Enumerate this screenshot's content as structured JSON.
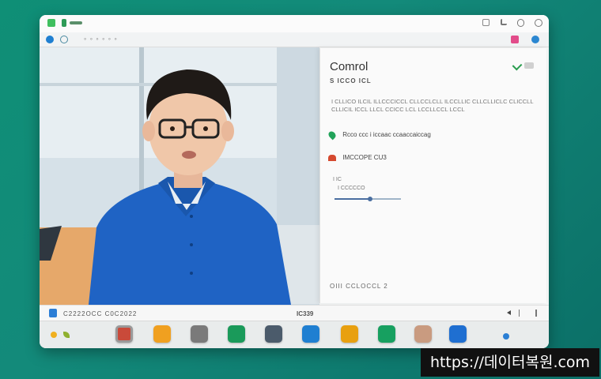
{
  "toolbar": {
    "address": "◦ ◦ ◦ ◦ ◦ ◦"
  },
  "panel": {
    "title": "Comrol",
    "subtitle": "S ICCO ICL",
    "description": "I CLLICO ILCIL ILLCCCICCL CLLCCLCLL ILCCLLIC CLLCLLICLC CLICCLL CLLICIL ICCL LLCL CCICC LCL LCCLLCCL LCCL",
    "option1": "Rcco ccc i iccaac ccaaccaiccag",
    "option2": "IMCCOPE CU3",
    "slider_label": "I IC",
    "slider_value_label": "I CCCCCO",
    "footer": "OIII CCLOCCL 2"
  },
  "statusbar": {
    "left": "C2222OCC C0C2022",
    "center": "IC339"
  },
  "colors": {
    "accent": "#1f7fd1",
    "green": "#22a35a",
    "brand_teal": "#0f8f76"
  },
  "dock_icons": [
    "terminal-icon",
    "files-icon",
    "text-editor-icon",
    "sheets-icon",
    "people-icon",
    "mail-icon",
    "notes-icon",
    "chart-icon",
    "avatar-icon",
    "settings-icon"
  ]
}
